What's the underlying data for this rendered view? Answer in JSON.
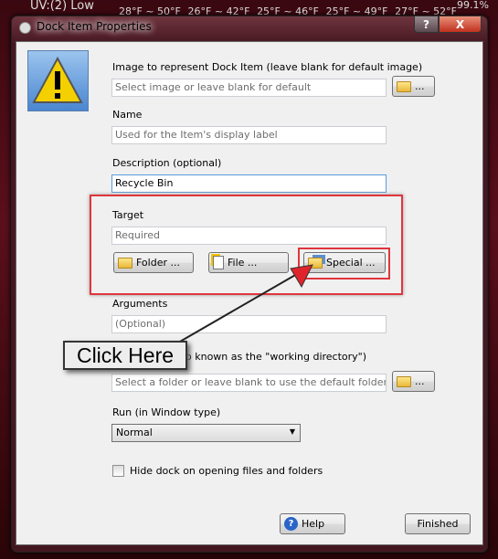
{
  "background": {
    "top_left": "UV:(2) Low",
    "temps": [
      "28°F ~ 50°F",
      "26°F ~ 42°F",
      "25°F ~ 46°F",
      "25°F ~ 49°F",
      "27°F ~ 52°F"
    ],
    "top_right": "99.1%"
  },
  "window": {
    "title": "Dock Item Properties",
    "help_caption": "?",
    "close_caption": "X"
  },
  "image": {
    "label": "Image to represent Dock Item (leave blank for default image)",
    "placeholder": "Select image or leave blank for default",
    "browse_label": "..."
  },
  "name": {
    "label": "Name",
    "placeholder": "Used for the Item's display label"
  },
  "description": {
    "label": "Description (optional)",
    "value": "Recycle Bin"
  },
  "target": {
    "label": "Target",
    "placeholder": "Required",
    "folder_button": "Folder ...",
    "file_button": "File ...",
    "special_button": "Special ..."
  },
  "arguments": {
    "label": "Arguments",
    "placeholder": "(Optional)"
  },
  "start_in": {
    "label": "o known as the \"working directory\")",
    "placeholder": "Select a folder or leave blank to use the default folder",
    "browse_label": "..."
  },
  "run": {
    "label": "Run (in  Window type)",
    "value": "Normal"
  },
  "hide_dock": {
    "label": "Hide dock on opening files and folders",
    "checked": false
  },
  "annotation": {
    "callout": "Click Here",
    "highlight_color": "#e0353d"
  },
  "footer": {
    "help_button": "Help",
    "finished_button": "Finished"
  }
}
